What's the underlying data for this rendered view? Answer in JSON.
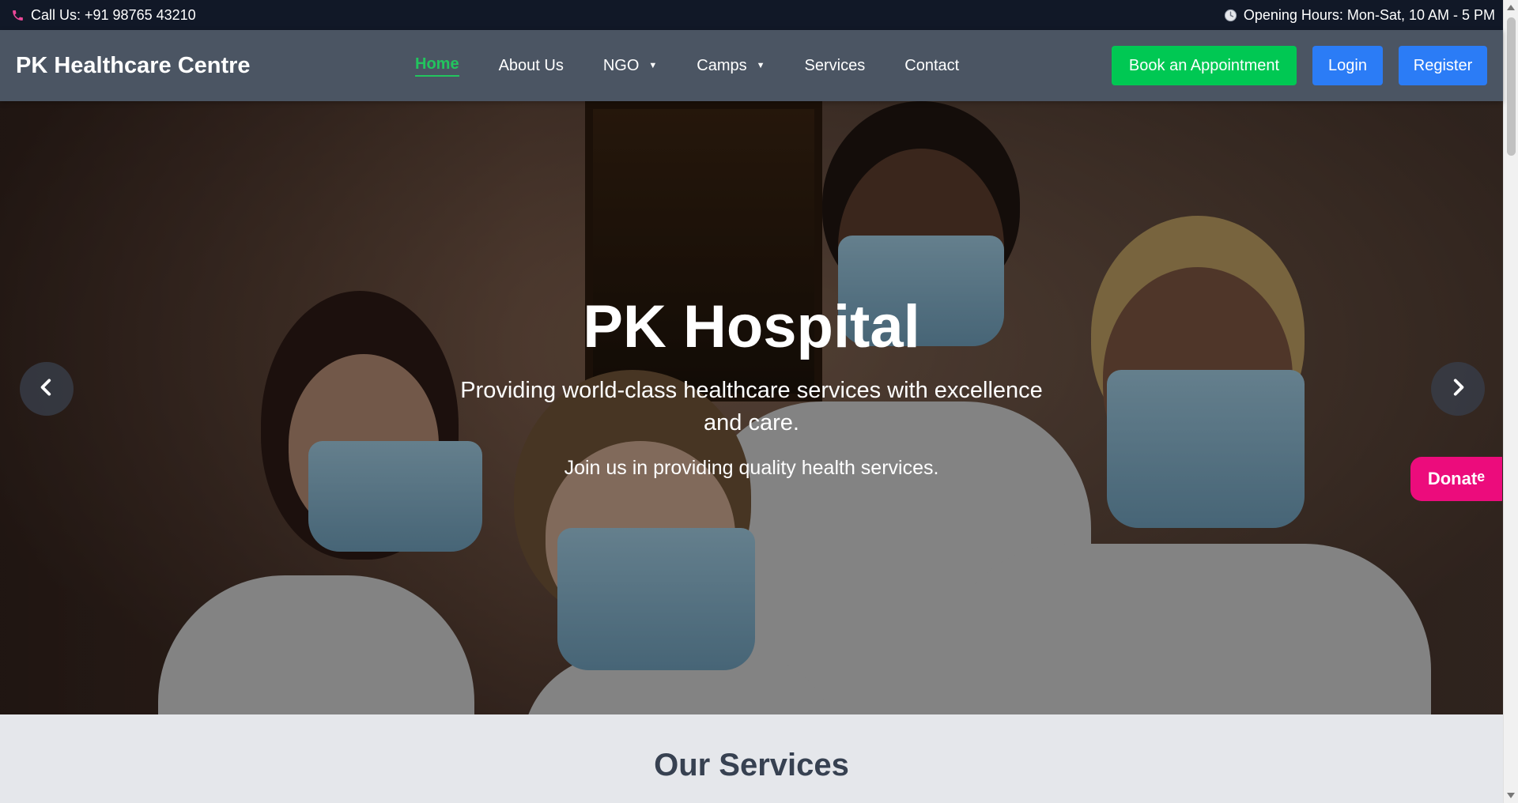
{
  "topbar": {
    "phone_text": "Call Us: +91 98765 43210",
    "hours_text": "Opening Hours: Mon-Sat, 10 AM - 5 PM",
    "phone_icon": "phone-icon",
    "clock_icon": "clock-icon"
  },
  "navbar": {
    "brand": "PK Healthcare Centre",
    "links": [
      {
        "label": "Home",
        "active": true
      },
      {
        "label": "About Us"
      },
      {
        "label": "NGO",
        "dropdown": true
      },
      {
        "label": "Camps",
        "dropdown": true
      },
      {
        "label": "Services"
      },
      {
        "label": "Contact"
      }
    ],
    "book_label": "Book an Appointment",
    "login_label": "Login",
    "register_label": "Register"
  },
  "hero": {
    "title": "PK Hospital",
    "subtitle": "Providing world-class healthcare services with excellence and care.",
    "tagline": "Join us in providing quality health services.",
    "prev_icon": "chevron-left-icon",
    "next_icon": "chevron-right-icon"
  },
  "donate": {
    "label_main": "Donat",
    "label_sup": "e"
  },
  "services": {
    "title": "Our Services"
  },
  "colors": {
    "topbar_bg": "#111827",
    "navbar_bg": "#4b5563",
    "active_link": "#22c55e",
    "book_button": "#00c853",
    "blue_button": "#2b7cf6",
    "donate": "#ec0c7c"
  }
}
